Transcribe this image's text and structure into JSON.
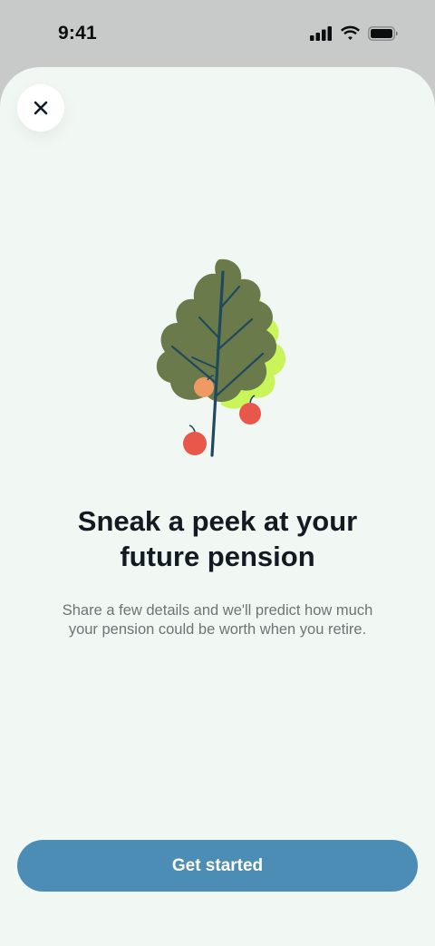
{
  "status_bar": {
    "time": "9:41"
  },
  "sheet": {
    "close_icon": "close-icon",
    "illustration": "apple-tree-illustration",
    "title_line1": "Sneak a peek at your",
    "title_line2": "future pension",
    "subtitle_line1": "Share a few details and we'll predict how much",
    "subtitle_line2": "your pension could be worth when you retire.",
    "cta_label": "Get started"
  },
  "colors": {
    "status_bar_bg": "#c8cac9",
    "sheet_bg": "#f1f7f3",
    "button_bg": "#4b8db5",
    "title": "#141a22",
    "subtitle": "#6e7375",
    "tree_leaf": "#6a7a4a",
    "tree_highlight": "#c9f55a",
    "tree_trunk": "#1f4a5e",
    "apple": "#e8574a"
  }
}
